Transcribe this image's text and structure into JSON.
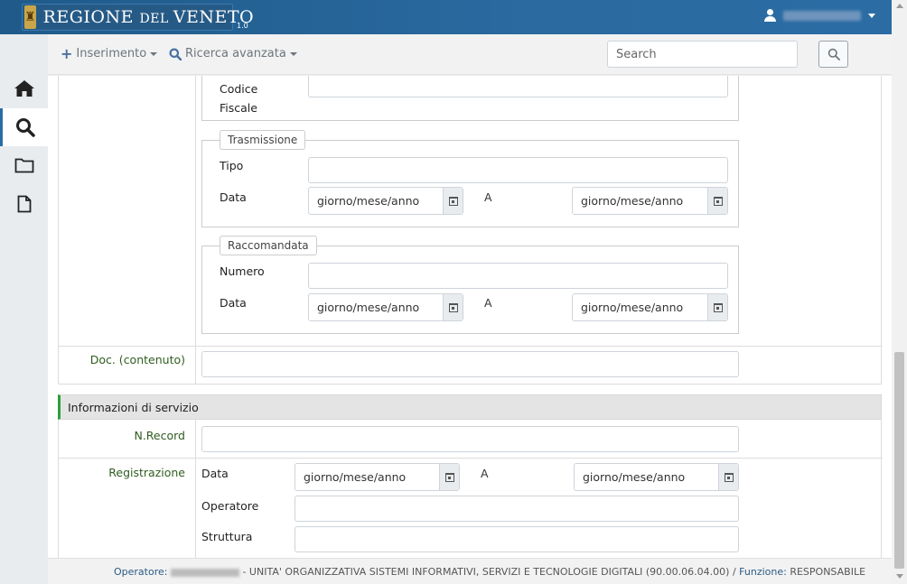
{
  "header": {
    "brand_main": "REGIONE ",
    "brand_small": "DEL ",
    "brand_end": "VENETO",
    "version": "1.0"
  },
  "toolbar": {
    "insert_label": "Inserimento",
    "advanced_search_label": "Ricerca avanzata",
    "search_placeholder": "Search"
  },
  "form": {
    "codice_fiscale": [
      "Codice",
      "Fiscale"
    ],
    "trasmissione": {
      "legend": "Trasmissione",
      "tipo_label": "Tipo",
      "data_label": "Data",
      "date_from": "giorno/mese/anno",
      "to_label": "A",
      "date_to": "giorno/mese/anno"
    },
    "raccomandata": {
      "legend": "Raccomandata",
      "numero_label": "Numero",
      "data_label": "Data",
      "date_from": "giorno/mese/anno",
      "to_label": "A",
      "date_to": "giorno/mese/anno"
    },
    "doc_contenuto_label": "Doc. (contenuto)"
  },
  "service": {
    "title": "Informazioni di servizio",
    "nrecord_label": "N.Record",
    "registrazione_label": "Registrazione",
    "data_label": "Data",
    "date_from": "giorno/mese/anno",
    "to_label": "A",
    "date_to": "giorno/mese/anno",
    "operatore_label": "Operatore",
    "struttura_label": "Struttura"
  },
  "footer": {
    "operatore_key": "Operatore:",
    "unit_text": " - UNITA' ORGANIZZATIVA SISTEMI INFORMATIVI, SERVIZI E TECNOLOGIE DIGITALI (90.00.06.04.00)  /  ",
    "funzione_key": "Funzione:",
    "funzione_value": " RESPONSABILE"
  },
  "sidebar": {
    "items": [
      "home-icon",
      "search-icon",
      "folder-icon",
      "document-icon"
    ]
  },
  "colors": {
    "header_blue": "#2b6ca4",
    "label_green": "#2f5d1f",
    "section_accent": "#2e9e3e"
  }
}
